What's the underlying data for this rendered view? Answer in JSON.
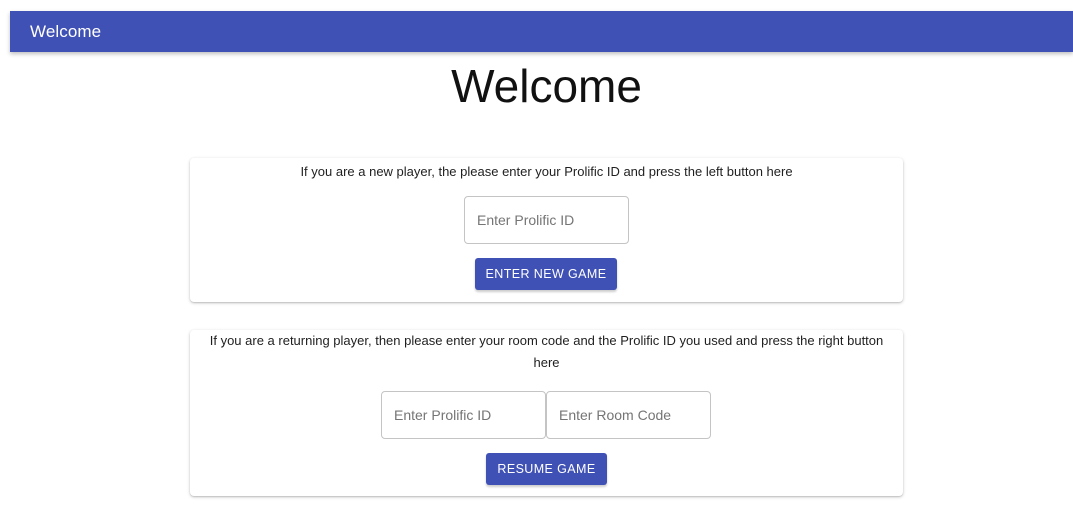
{
  "appbar": {
    "title": "Welcome",
    "color": "#3f51b5"
  },
  "heading": "Welcome",
  "new_player": {
    "instructions": "If you are a new player, the please enter your Prolific ID and press the left button here",
    "prolific_placeholder": "Enter Prolific ID",
    "button_label": "ENTER NEW GAME"
  },
  "returning_player": {
    "instructions": "If you are a returning player, then please enter your room code and the Prolific ID you used and press the right button here",
    "prolific_placeholder": "Enter Prolific ID",
    "room_placeholder": "Enter Room Code",
    "button_label": "RESUME GAME"
  }
}
